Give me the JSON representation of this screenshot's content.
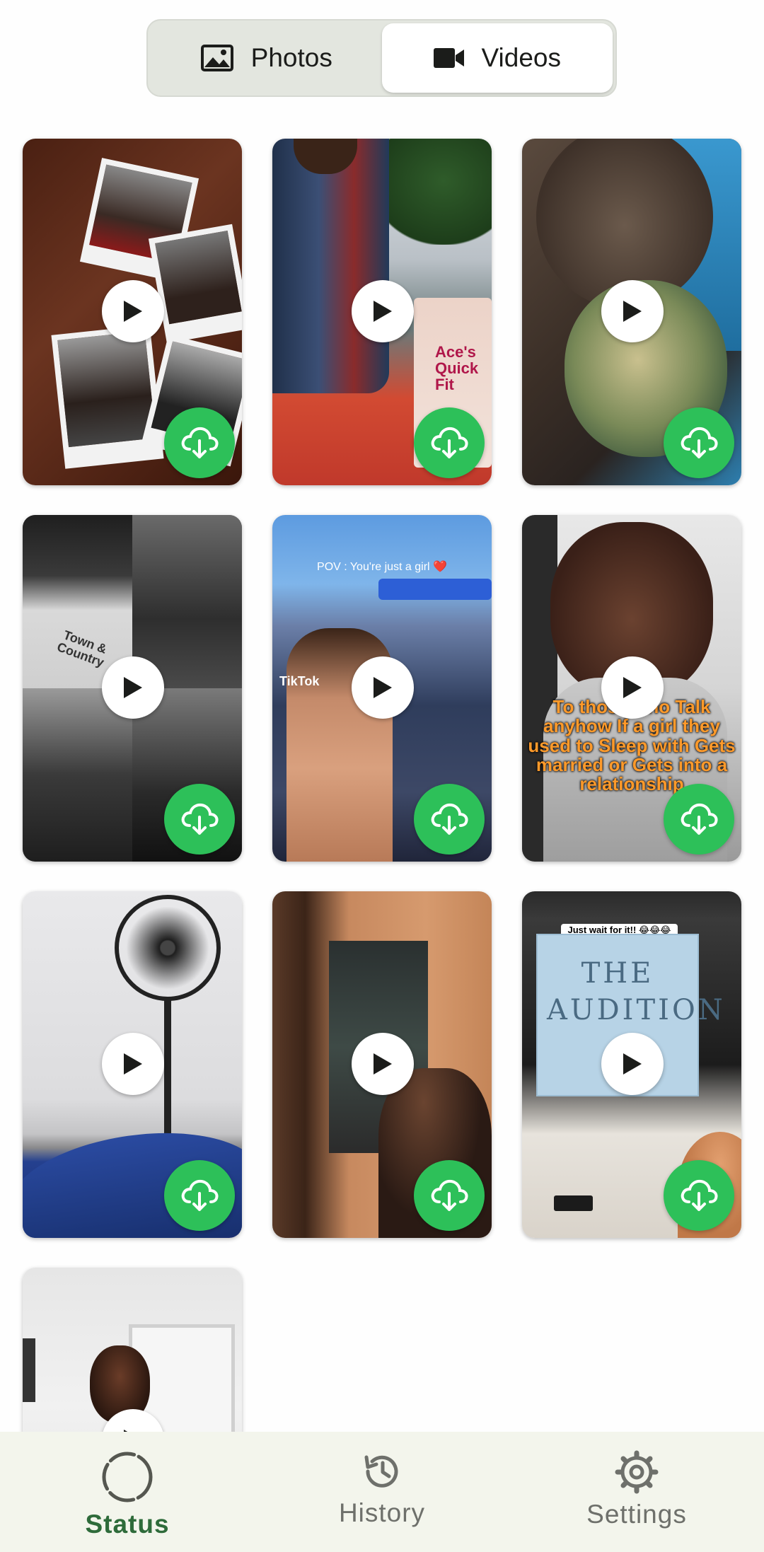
{
  "segments": {
    "photos_label": "Photos",
    "videos_label": "Videos",
    "selected": "Videos"
  },
  "tiles": [
    {
      "caption": ""
    },
    {
      "caption": "Ace's Quick Fit"
    },
    {
      "caption": ""
    },
    {
      "caption": "Town & Country"
    },
    {
      "caption": "POV : You're just a girl ❤️",
      "watermark": "TikTok"
    },
    {
      "caption": "To those who Talk anyhow If a girl they used to Sleep with Gets married or Gets into a relationship"
    },
    {
      "caption": ""
    },
    {
      "caption": ""
    },
    {
      "caption": "Just wait for it!! 😂😂😂😂😂😂",
      "sign": "THE AUDITION"
    },
    {
      "caption": ""
    }
  ],
  "nav": {
    "status_label": "Status",
    "history_label": "History",
    "settings_label": "Settings",
    "active": "Status"
  },
  "colors": {
    "accent_green": "#2dc059",
    "nav_active": "#2e6b3a",
    "nav_bg": "#f3f5ec"
  },
  "icons": [
    "image-icon",
    "video-camera-icon",
    "play-icon",
    "cloud-download-icon",
    "status-ring-icon",
    "history-icon",
    "settings-gear-icon"
  ]
}
